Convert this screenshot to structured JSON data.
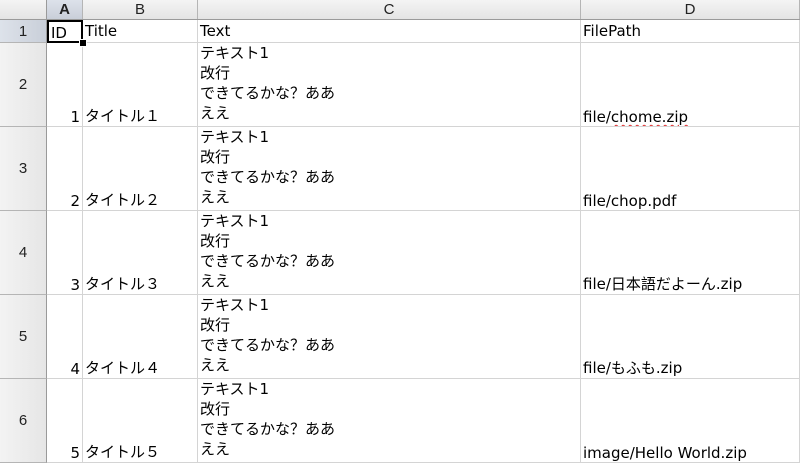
{
  "columns": [
    {
      "letter": "A",
      "active": true
    },
    {
      "letter": "B",
      "active": false
    },
    {
      "letter": "C",
      "active": false
    },
    {
      "letter": "D",
      "active": false
    }
  ],
  "header_row": {
    "row_number": "1",
    "cells": [
      "ID",
      "Title",
      "Text",
      "FilePath"
    ]
  },
  "rows": [
    {
      "row_number": "2",
      "id": "1",
      "title": "タイトル１",
      "text": "テキスト1\n改行\nできてるかな？ああ\nええ",
      "filepath": "file/chome.zip"
    },
    {
      "row_number": "3",
      "id": "2",
      "title": "タイトル２",
      "text": "テキスト1\n改行\nできてるかな？ああ\nええ",
      "filepath": "file/chop.pdf"
    },
    {
      "row_number": "4",
      "id": "3",
      "title": "タイトル３",
      "text": "テキスト1\n改行\nできてるかな？ああ\nええ",
      "filepath": "file/日本語だよーん.zip"
    },
    {
      "row_number": "5",
      "id": "4",
      "title": "タイトル４",
      "text": "テキスト1\n改行\nできてるかな？ああ\nええ",
      "filepath": "file/もふも.zip"
    },
    {
      "row_number": "6",
      "id": "5",
      "title": "タイトル５",
      "text": "テキスト1\n改行\nできてるかな？ああ\nええ",
      "filepath": "image/Hello World.zip"
    }
  ],
  "selected_cell": "A1",
  "spellcheck_flag": {
    "row": "2",
    "column": "D",
    "word": "chome.zip"
  }
}
